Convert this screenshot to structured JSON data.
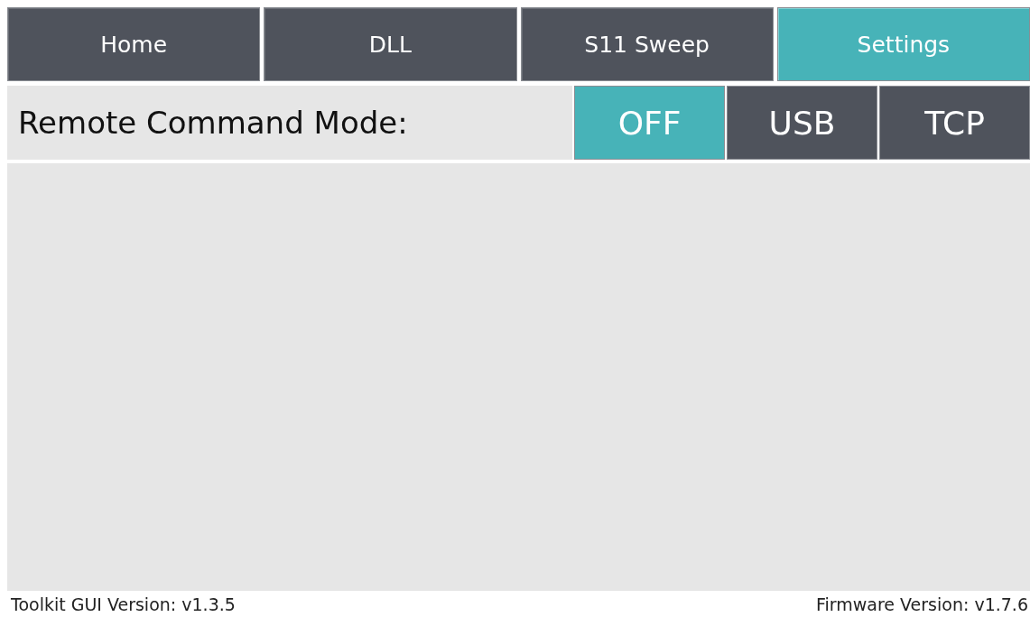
{
  "tabs": [
    {
      "label": "Home",
      "selected": false
    },
    {
      "label": "DLL",
      "selected": false
    },
    {
      "label": "S11 Sweep",
      "selected": false
    },
    {
      "label": "Settings",
      "selected": true
    }
  ],
  "remote_mode": {
    "label": "Remote Command Mode:",
    "options": [
      {
        "label": "OFF",
        "selected": true
      },
      {
        "label": "USB",
        "selected": false
      },
      {
        "label": "TCP",
        "selected": false
      }
    ]
  },
  "status_bar": {
    "left": "Toolkit GUI Version: v1.3.5",
    "right": "Firmware Version: v1.7.6"
  }
}
